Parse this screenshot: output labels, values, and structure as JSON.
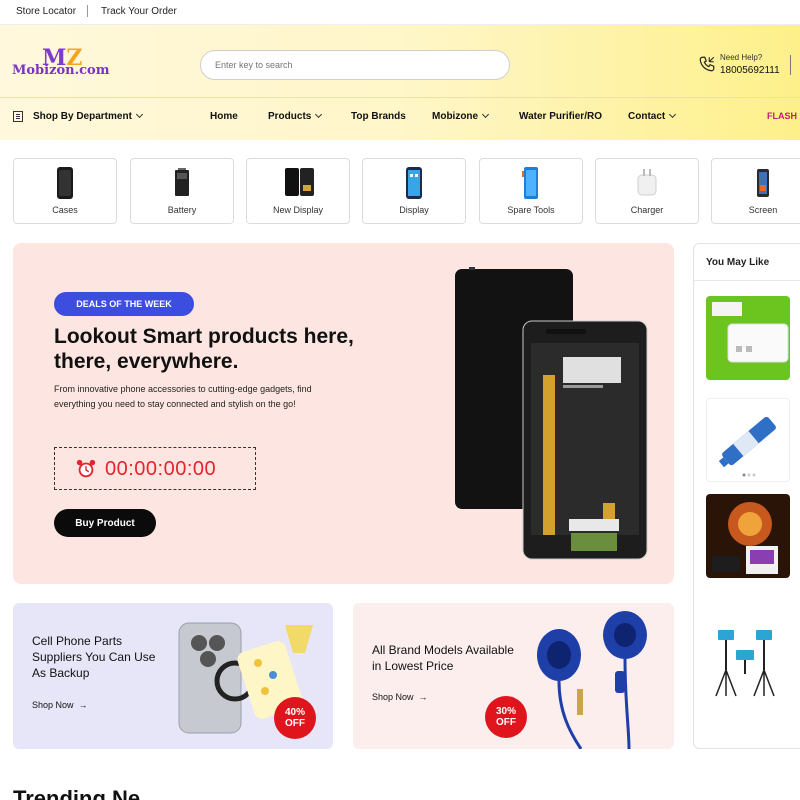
{
  "topbar": {
    "store_locator": "Store Locator",
    "track_order": "Track Your Order"
  },
  "header": {
    "logo_name": "Mobizon.com",
    "logo_mark_left": "M",
    "logo_mark_right": "Z",
    "search_placeholder": "Enter key to search",
    "help_label": "Need Help?",
    "help_number": "18005692111"
  },
  "nav": {
    "department": "Shop By Department",
    "items": [
      "Home",
      "Products",
      "Top Brands",
      "Mobizone",
      "Water Purifier/RO",
      "Contact"
    ],
    "flash": "FLASH D"
  },
  "categories": [
    "Cases",
    "Battery",
    "New Display",
    "Display",
    "Spare Tools",
    "Charger",
    "Screen"
  ],
  "hero": {
    "badge": "DEALS OF THE WEEK",
    "title": "Lookout Smart products here, there, everywhere.",
    "description": "From innovative phone accessories to cutting-edge gadgets, find everything you need to stay connected and stylish on the go!",
    "timer": "00:00:00:00",
    "cta": "Buy Product",
    "accent_color": "#3c4de0"
  },
  "sidebar": {
    "title": "You May Like"
  },
  "promos": [
    {
      "title": "Cell Phone Parts Suppliers You Can Use As Backup",
      "shop": "Shop Now",
      "discount": "40%",
      "discount_word": "OFF"
    },
    {
      "title": "All Brand Models Available in Lowest Price",
      "shop": "Shop Now",
      "discount": "30%",
      "discount_word": "OFF"
    }
  ],
  "section_heading": "Trending Ne"
}
